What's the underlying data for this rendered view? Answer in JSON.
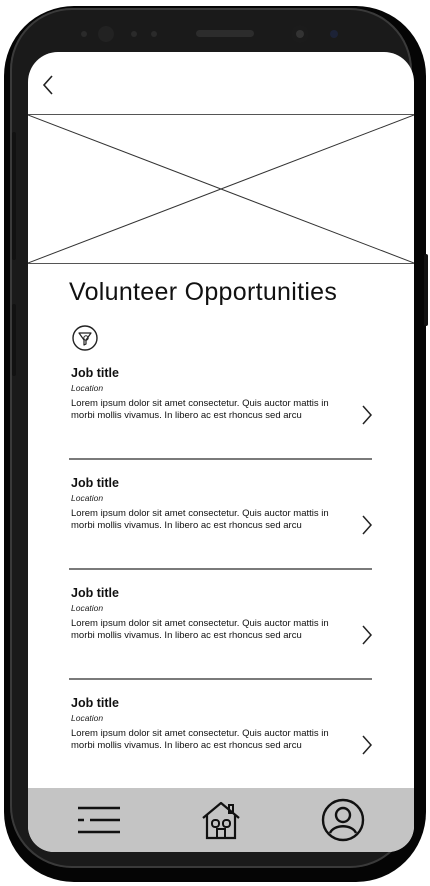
{
  "header": {
    "back_icon": "chevron-left-icon"
  },
  "hero": {
    "image_icon": "image-placeholder-icon"
  },
  "page": {
    "title": "Volunteer Opportunities",
    "filter_icon": "filter-icon"
  },
  "jobs": [
    {
      "title": "Job title",
      "location": "Location",
      "description": "Lorem ipsum dolor sit amet consectetur. Quis auctor mattis in morbi mollis vivamus. In libero ac est rhoncus sed arcu"
    },
    {
      "title": "Job title",
      "location": "Location",
      "description": "Lorem ipsum dolor sit amet consectetur. Quis auctor mattis in morbi mollis vivamus. In libero ac est rhoncus sed arcu"
    },
    {
      "title": "Job title",
      "location": "Location",
      "description": "Lorem ipsum dolor sit amet consectetur. Quis auctor mattis in morbi mollis vivamus. In libero ac est rhoncus sed arcu"
    },
    {
      "title": "Job title",
      "location": "Location",
      "description": "Lorem ipsum dolor sit amet consectetur. Quis auctor mattis in morbi mollis vivamus. In libero ac est rhoncus sed arcu"
    }
  ],
  "tabbar": {
    "menu_icon": "menu-icon",
    "home_icon": "home-icon",
    "profile_icon": "profile-icon"
  },
  "colors": {
    "tabbar_bg": "#c4c4c4",
    "divider": "#7a7a7a",
    "phone_frame": "#050505"
  }
}
